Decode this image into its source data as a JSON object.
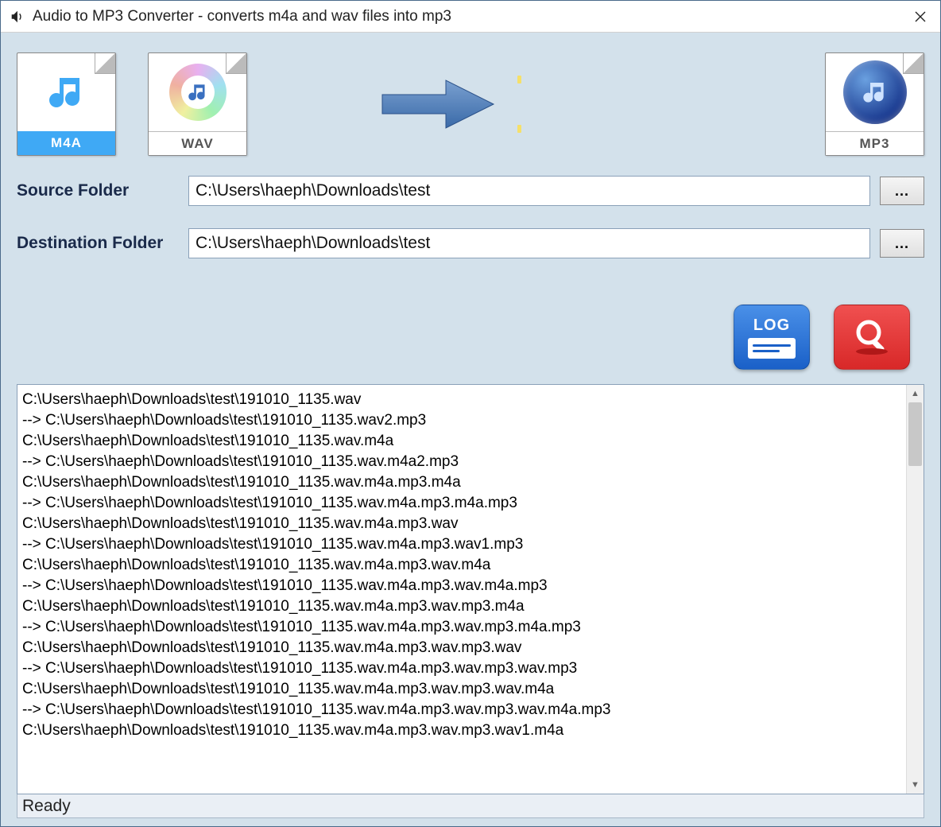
{
  "window": {
    "title": "Audio to MP3 Converter - converts m4a and wav files into mp3"
  },
  "filetypes": {
    "m4a_label": "M4A",
    "wav_label": "WAV",
    "mp3_label": "MP3"
  },
  "folders": {
    "source_label": "Source Folder",
    "source_value": "C:\\Users\\haeph\\Downloads\\test",
    "dest_label": "Destination Folder",
    "dest_value": "C:\\Users\\haeph\\Downloads\\test",
    "browse_label": "..."
  },
  "buttons": {
    "log_label": "LOG"
  },
  "log": {
    "lines": [
      "C:\\Users\\haeph\\Downloads\\test\\191010_1135.wav",
      " --> C:\\Users\\haeph\\Downloads\\test\\191010_1135.wav2.mp3",
      "C:\\Users\\haeph\\Downloads\\test\\191010_1135.wav.m4a",
      " --> C:\\Users\\haeph\\Downloads\\test\\191010_1135.wav.m4a2.mp3",
      "C:\\Users\\haeph\\Downloads\\test\\191010_1135.wav.m4a.mp3.m4a",
      " --> C:\\Users\\haeph\\Downloads\\test\\191010_1135.wav.m4a.mp3.m4a.mp3",
      "C:\\Users\\haeph\\Downloads\\test\\191010_1135.wav.m4a.mp3.wav",
      " --> C:\\Users\\haeph\\Downloads\\test\\191010_1135.wav.m4a.mp3.wav1.mp3",
      "C:\\Users\\haeph\\Downloads\\test\\191010_1135.wav.m4a.mp3.wav.m4a",
      " --> C:\\Users\\haeph\\Downloads\\test\\191010_1135.wav.m4a.mp3.wav.m4a.mp3",
      "C:\\Users\\haeph\\Downloads\\test\\191010_1135.wav.m4a.mp3.wav.mp3.m4a",
      " --> C:\\Users\\haeph\\Downloads\\test\\191010_1135.wav.m4a.mp3.wav.mp3.m4a.mp3",
      "C:\\Users\\haeph\\Downloads\\test\\191010_1135.wav.m4a.mp3.wav.mp3.wav",
      " --> C:\\Users\\haeph\\Downloads\\test\\191010_1135.wav.m4a.mp3.wav.mp3.wav.mp3",
      "C:\\Users\\haeph\\Downloads\\test\\191010_1135.wav.m4a.mp3.wav.mp3.wav.m4a",
      " --> C:\\Users\\haeph\\Downloads\\test\\191010_1135.wav.m4a.mp3.wav.mp3.wav.m4a.mp3",
      "C:\\Users\\haeph\\Downloads\\test\\191010_1135.wav.m4a.mp3.wav.mp3.wav1.m4a"
    ]
  },
  "status": "Ready"
}
